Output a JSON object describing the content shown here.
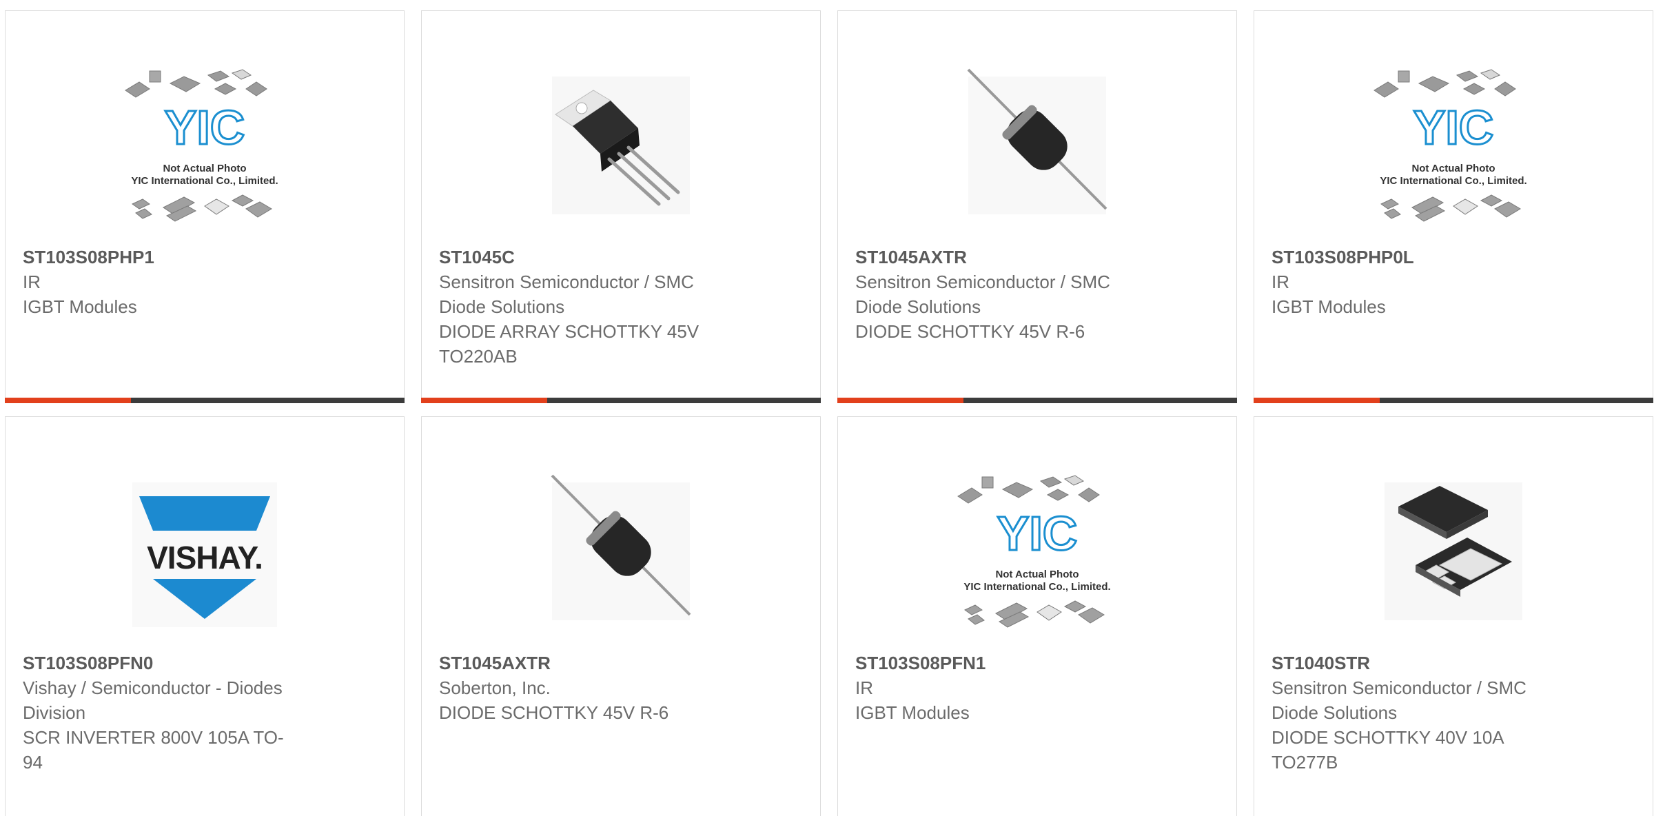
{
  "products": [
    {
      "part": "ST103S08PHP1",
      "lines": [
        "IR",
        "IGBT Modules"
      ],
      "image": "not-actual-photo-placeholder"
    },
    {
      "part": "ST1045C",
      "lines": [
        "Sensitron Semiconductor / SMC",
        "Diode Solutions",
        "DIODE ARRAY SCHOTTKY 45V",
        "TO220AB"
      ],
      "image": "to220-package"
    },
    {
      "part": "ST1045AXTR",
      "lines": [
        "Sensitron Semiconductor / SMC",
        "Diode Solutions",
        "DIODE SCHOTTKY 45V R-6"
      ],
      "image": "axial-diode"
    },
    {
      "part": "ST103S08PHP0L",
      "lines": [
        "IR",
        "IGBT Modules"
      ],
      "image": "not-actual-photo-placeholder"
    },
    {
      "part": "ST103S08PFN0",
      "lines": [
        "Vishay / Semiconductor - Diodes",
        "Division",
        "SCR INVERTER 800V 105A TO-",
        "94"
      ],
      "image": "vishay-logo"
    },
    {
      "part": "ST1045AXTR",
      "lines": [
        "Soberton, Inc.",
        "DIODE SCHOTTKY 45V R-6"
      ],
      "image": "axial-diode"
    },
    {
      "part": "ST103S08PFN1",
      "lines": [
        "IR",
        "IGBT Modules"
      ],
      "image": "not-actual-photo-placeholder"
    },
    {
      "part": "ST1040STR",
      "lines": [
        "Sensitron Semiconductor / SMC",
        "Diode Solutions",
        "DIODE SCHOTTKY 40V 10A",
        "TO277B"
      ],
      "image": "to277-package"
    }
  ],
  "placeholder": {
    "brand": "YIC",
    "line1": "Not Actual Photo",
    "line2": "YIC International Co., Limited."
  },
  "vishay_logo_text": "VISHAY.",
  "colors": {
    "accent": "#e2401c",
    "bar": "#3c3c3c",
    "border": "#dcdcdc",
    "text": "#6b6b6b"
  }
}
